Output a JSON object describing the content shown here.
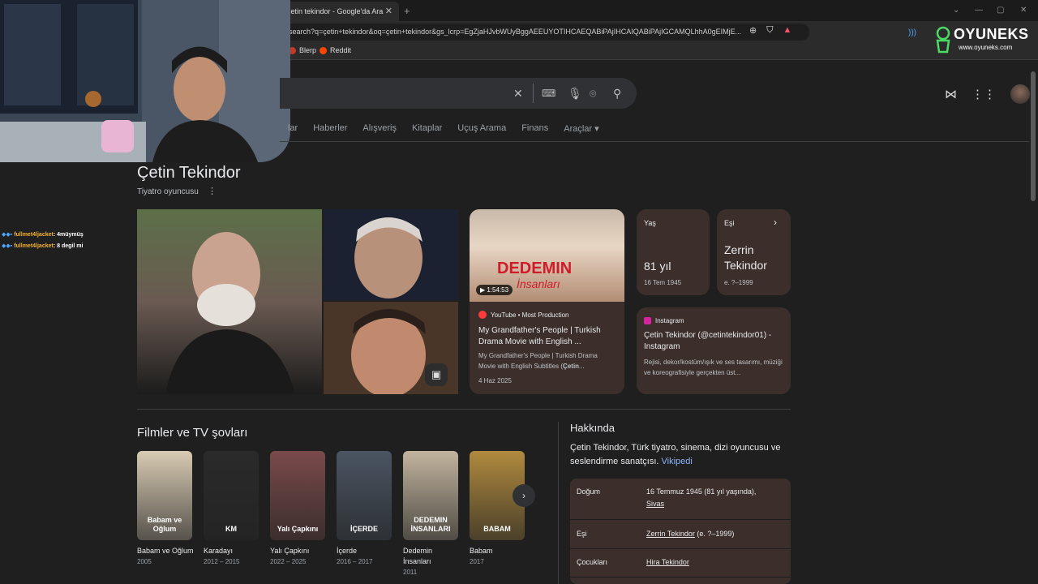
{
  "browser": {
    "tab_title": "çetin tekindor - Google'da Ara",
    "tab_close": "✕",
    "new_tab": "+",
    "url": "search?q=çetin+tekindor&oq=çetin+tekindor&gs_lcrp=EgZjaHJvbWUyBggAEEUYOTIHCAEQABiPAjIHCAIQABiPAjIGCAMQLhhA0gEIMjE...",
    "bookmarks": [
      "Blerp",
      "Reddit"
    ]
  },
  "overlay": {
    "logo_name": "OYUNEKS",
    "logo_site": "www.oyuneks.com",
    "chat": [
      {
        "user": "fullmet4ljacket",
        "msg": ": 4müymüş"
      },
      {
        "user": "fullmet4ljacket",
        "msg": ": 8 degil mi"
      }
    ]
  },
  "search": {
    "nav_tabs": [
      "lar",
      "Haberler",
      "Alışveriş",
      "Kitaplar",
      "Uçuş Arama",
      "Finans",
      "Araçlar ▾"
    ]
  },
  "entity": {
    "name": "Çetin Tekindor",
    "subtitle": "Tiyatro oyuncusu",
    "more": "⋮"
  },
  "video": {
    "duration": "▶ 1:54:53",
    "brand_top": "DEDEMIN",
    "brand_bottom": "İnsanları",
    "source": "YouTube • Most Production",
    "title": "My Grandfather's People | Turkish Drama Movie with English ...",
    "desc_plain": "My Grandfather's People | Turkish Drama Movie with English Subtitles (",
    "desc_bold": "Çetin",
    "desc_end": "...",
    "date": "4 Haz 2025"
  },
  "age_card": {
    "label": "Yaş",
    "value": "81 yıl",
    "sub": "16 Tem 1945"
  },
  "spouse_card": {
    "label": "Eşi",
    "value_line1": "Zerrin",
    "value_line2": "Tekindor",
    "sub": "e. ?–1999"
  },
  "instagram": {
    "source": "Instagram",
    "title": "Çetin Tekindor (@cetintekindor01) - Instagram",
    "desc": "Rejisi, dekor/kostüm/ışık ve ses tasarımı, müziği ve koreografisiyle gerçekten üst..."
  },
  "films": {
    "heading": "Filmler ve TV şovları",
    "items": [
      {
        "title": "Babam ve Oğlum",
        "year": "2005",
        "poster_text": "Babam ve Oğlum",
        "color": "#d9cbb3"
      },
      {
        "title": "Karadayı",
        "year": "2012 – 2015",
        "poster_text": "KM",
        "color": "#2a2a2a"
      },
      {
        "title": "Yalı Çapkını",
        "year": "2022 – 2025",
        "poster_text": "Yalı Çapkını",
        "color": "#7a4a4a"
      },
      {
        "title": "İçerde",
        "year": "2016 – 2017",
        "poster_text": "İÇERDE",
        "color": "#4a5563"
      },
      {
        "title": "Dedemin İnsanları",
        "year": "2011",
        "poster_text": "DEDEMIN İNSANLARI",
        "color": "#c2b49e"
      },
      {
        "title": "Babam",
        "year": "2017",
        "poster_text": "BABAM",
        "color": "#b08a3e"
      }
    ]
  },
  "about": {
    "heading": "Hakkında",
    "text": "Çetin Tekindor, Türk tiyatro, sinema, dizi oyuncusu ve seslendirme sanatçısı.",
    "link": "Vikipedi",
    "facts": [
      {
        "label": "Doğum",
        "value1": "16 Temmuz 1945 (81 yıl yaşında),",
        "value2": "Sivas"
      },
      {
        "label": "Eşi",
        "value1": "Zerrin Tekindor",
        "value_extra": " (e. ?–1999)"
      },
      {
        "label": "Çocukları",
        "value1": "Hira Tekindor"
      }
    ]
  }
}
